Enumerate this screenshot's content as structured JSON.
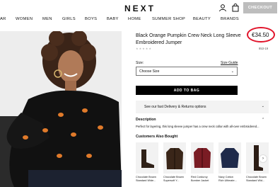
{
  "header": {
    "logo": "NEXT",
    "checkout_label": "CHECKOUT"
  },
  "nav": {
    "items": [
      "AR",
      "WOMEN",
      "MEN",
      "GIRLS",
      "BOYS",
      "BABY",
      "HOME",
      "SUMMER SHOP",
      "BEAUTY",
      "BRANDS"
    ]
  },
  "product": {
    "title": "Black Orange Pumpkin Crew Neck Long Sleeve Embroidered Jumper",
    "price": "€34.50",
    "sku": "853-19",
    "size_label": "Size:",
    "size_guide": "Size Guide",
    "size_select": "Choose Size",
    "add_to_bag": "ADD TO BAG",
    "delivery_text": "See our fast Delivery & Returns options",
    "description_heading": "Description",
    "description_text": "Perfect for layering, this long sleeve jumper has a crew neck collar with all-over embroidered..."
  },
  "also_bought": {
    "heading": "Customers Also Bought",
    "items": [
      {
        "line1": "Chocolate Brown",
        "line2": "Standard Wide..."
      },
      {
        "line1": "Chocolate Brown",
        "line2": "Supersoft Y..."
      },
      {
        "line1": "Red Corduroy",
        "line2": "Bomber Jacket"
      },
      {
        "line1": "Navy Cotton",
        "line2": "Rich Ultimate..."
      },
      {
        "line1": "Chocolate Brown",
        "line2": "Standard Wid..."
      }
    ]
  },
  "colors": {
    "accent_ring": "#e1132a",
    "checkout_bg": "#bdbdbd",
    "button_bg": "#000000"
  }
}
